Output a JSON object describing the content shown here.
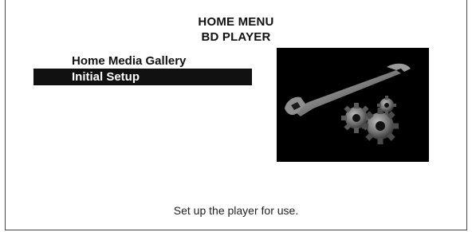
{
  "header": {
    "title": "HOME MENU",
    "subtitle": "BD PLAYER"
  },
  "menu": {
    "items": [
      {
        "label": "Home Media Gallery",
        "selected": false
      },
      {
        "label": "Initial Setup",
        "selected": true
      }
    ]
  },
  "preview": {
    "icon": "wrench-and-gears-icon"
  },
  "footer": {
    "description": "Set up the player for use."
  },
  "colors": {
    "highlight_bg": "#111111",
    "highlight_text": "#ffffff",
    "preview_bg": "#000000"
  }
}
